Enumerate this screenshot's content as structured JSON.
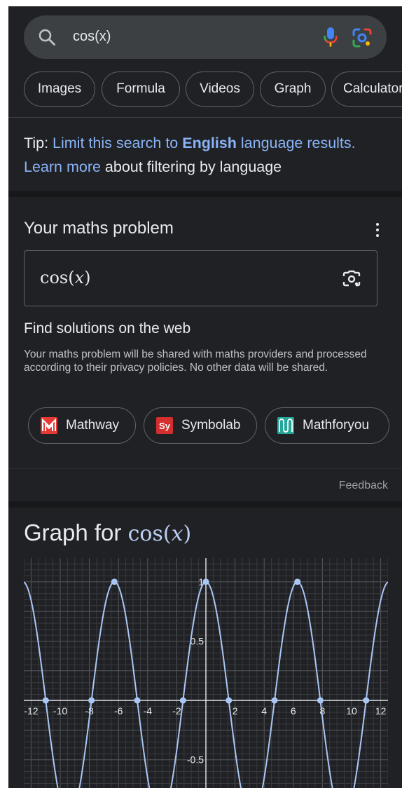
{
  "search": {
    "query": "cos(x)",
    "icons": [
      "search-icon",
      "mic-icon",
      "lens-icon"
    ]
  },
  "chips": [
    "Images",
    "Formula",
    "Videos",
    "Graph",
    "Calculator"
  ],
  "tip": {
    "prefix": "Tip: ",
    "link_part1": "Limit this search to ",
    "link_bold": "English",
    "link_part2": " language results.",
    "learn_more": "Learn more",
    "suffix": " about filtering by language"
  },
  "maths": {
    "title": "Your maths problem",
    "expression_fn": "cos",
    "expression_var": "x",
    "find_title": "Find solutions on the web",
    "find_desc": "Your maths problem will be shared with maths providers and processed according to their privacy policies. No other data will be shared.",
    "providers": [
      {
        "name": "Mathway",
        "logo_color": "#e53935"
      },
      {
        "name": "Symbolab",
        "logo_color": "#d32f2f",
        "logo_text": "Sy"
      },
      {
        "name": "Mathforyou",
        "logo_color": "#26a69a"
      }
    ],
    "feedback": "Feedback"
  },
  "graph": {
    "title": "Graph for ",
    "fn_label": "cos",
    "var_label": "x"
  },
  "chart_data": {
    "type": "line",
    "function": "cos(x)",
    "xlim": [
      -12.5,
      12.5
    ],
    "ylim": [
      -0.75,
      1.2
    ],
    "x_ticks": [
      -12,
      -10,
      -8,
      -6,
      -4,
      -2,
      2,
      4,
      6,
      8,
      10,
      12
    ],
    "x_tick_labels": [
      "-12",
      "-10",
      "-8",
      "-6",
      "-4",
      "-2",
      "2",
      "4",
      "6",
      "8",
      "10",
      "12"
    ],
    "y_ticks": [
      1,
      0.5,
      -0.5
    ],
    "y_tick_labels": [
      "1",
      "0.5",
      "-0.5"
    ],
    "grid": true,
    "line_color": "#aac6f5",
    "marked_points": [
      {
        "x": -10.996,
        "y": 0
      },
      {
        "x": -7.854,
        "y": 0
      },
      {
        "x": -6.283,
        "y": 1
      },
      {
        "x": -4.712,
        "y": 0
      },
      {
        "x": -1.571,
        "y": 0
      },
      {
        "x": 0,
        "y": 1
      },
      {
        "x": 1.571,
        "y": 0
      },
      {
        "x": 4.712,
        "y": 0
      },
      {
        "x": 6.283,
        "y": 1
      },
      {
        "x": 7.854,
        "y": 0
      },
      {
        "x": 10.996,
        "y": 0
      }
    ]
  }
}
